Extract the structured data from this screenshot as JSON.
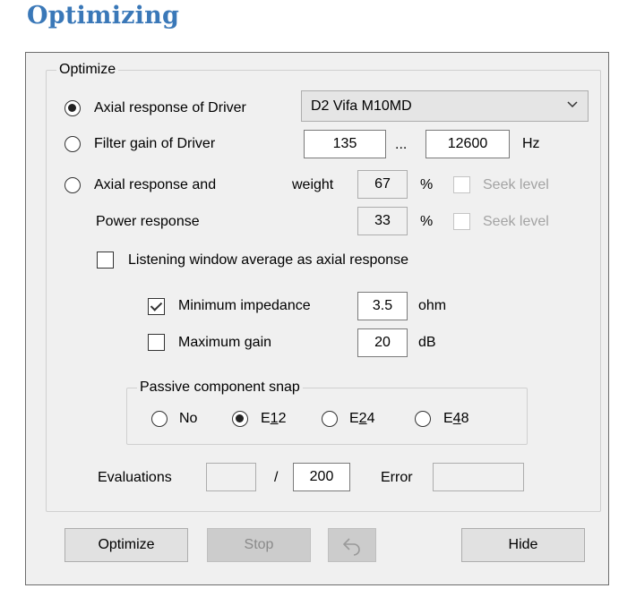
{
  "heading": "Optimizing",
  "optimize_group": {
    "title": "Optimize",
    "option_axial": {
      "label": "Axial response of Driver",
      "selected": true
    },
    "driver_select": {
      "value": "D2 Vifa M10MD"
    },
    "option_filter": {
      "label": "Filter gain of Driver",
      "selected": false
    },
    "freq_low": "135",
    "freq_sep": "...",
    "freq_high": "12600",
    "freq_unit": "Hz",
    "option_axial_power": {
      "label": "Axial response and",
      "selected": false
    },
    "weight_label": "weight",
    "axial_weight": "67",
    "power_label": "Power response",
    "power_weight": "33",
    "percent_unit": "%",
    "seek_level_label": "Seek level",
    "listening_window": {
      "label": "Listening window average as axial response",
      "checked": false
    },
    "min_impedance": {
      "label": "Minimum impedance",
      "checked": true,
      "value": "3.5",
      "unit": "ohm"
    },
    "max_gain": {
      "label": "Maximum gain",
      "checked": false,
      "value": "20",
      "unit": "dB"
    },
    "snap_group": {
      "title": "Passive component snap",
      "options": [
        {
          "label": "No",
          "selected": false
        },
        {
          "label_pre": "E",
          "label_ul": "1",
          "label_post": "2",
          "selected": true
        },
        {
          "label_pre": "E",
          "label_ul": "2",
          "label_post": "4",
          "selected": false
        },
        {
          "label_pre": "E",
          "label_ul": "4",
          "label_post": "8",
          "selected": false
        }
      ]
    },
    "evaluations_label": "Evaluations",
    "evaluations_current": "",
    "evaluations_sep": "/",
    "evaluations_max": "200",
    "error_label": "Error",
    "error_value": ""
  },
  "buttons": {
    "optimize": "Optimize",
    "stop": "Stop",
    "undo_icon": "undo-arrow-icon",
    "hide": "Hide"
  }
}
